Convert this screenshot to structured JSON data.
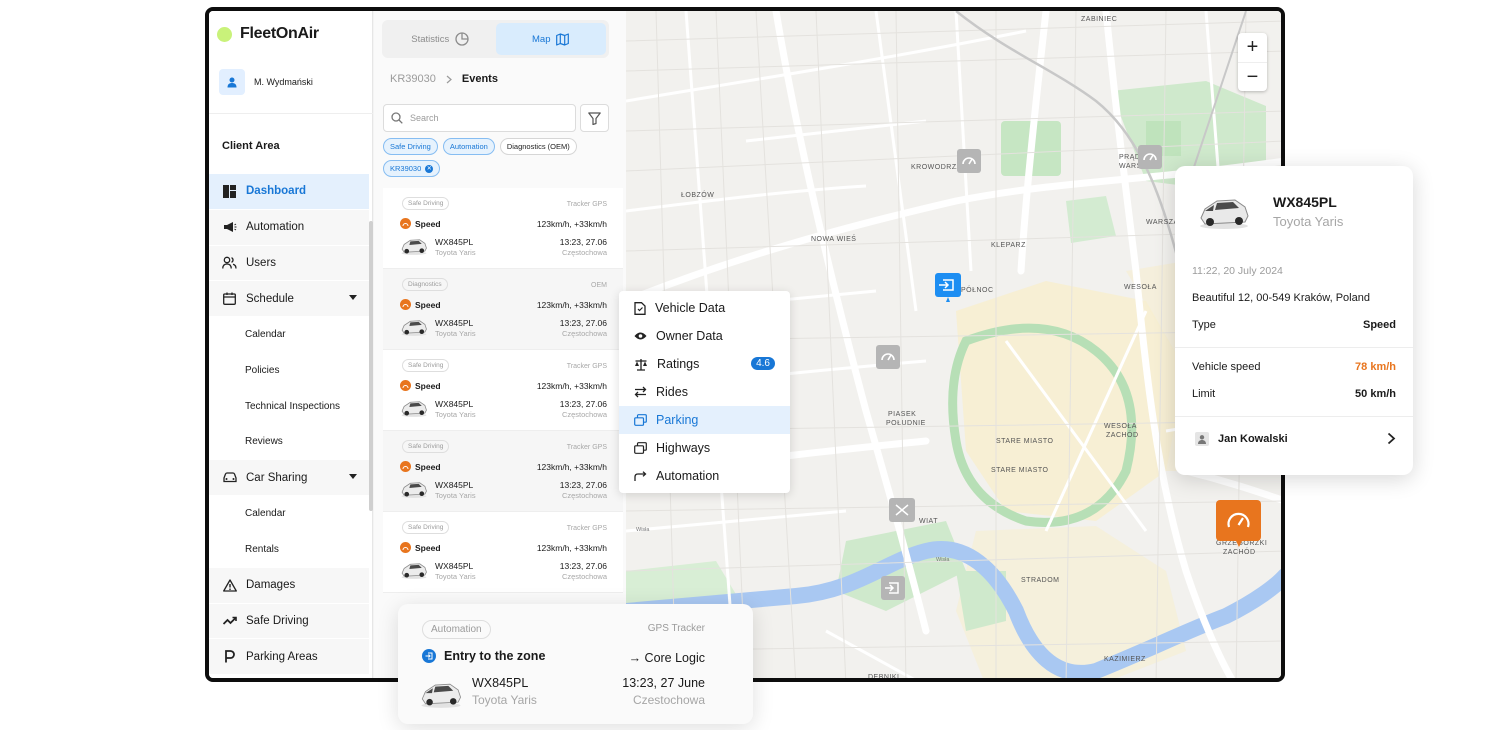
{
  "app": {
    "brand": "FleetOnAir",
    "user_name": "M. Wydmański",
    "section": "Client Area"
  },
  "sidebar": {
    "items": [
      {
        "label": "Dashboard"
      },
      {
        "label": "Automation"
      },
      {
        "label": "Users"
      },
      {
        "label": "Schedule"
      },
      {
        "label": "Calendar"
      },
      {
        "label": "Policies"
      },
      {
        "label": "Technical Inspections"
      },
      {
        "label": "Reviews"
      },
      {
        "label": "Car Sharing"
      },
      {
        "label": "Calendar"
      },
      {
        "label": "Rentals"
      },
      {
        "label": "Damages"
      },
      {
        "label": "Safe Driving"
      },
      {
        "label": "Parking Areas"
      }
    ]
  },
  "panel": {
    "tabs": [
      {
        "label": "Statistics"
      },
      {
        "label": "Map"
      }
    ],
    "breadcrumb": {
      "parent": "KR39030",
      "current": "Events"
    },
    "search_placeholder": "Search",
    "chips": [
      "Safe Driving",
      "Automation",
      "Diagnostics (OEM)",
      "KR39030"
    ],
    "events": [
      {
        "tag": "Safe Driving",
        "source": "Tracker GPS",
        "type": "Speed",
        "speed": "123km/h, +33km/h",
        "plate": "WX845PL",
        "model": "Toyota Yaris",
        "time": "13:23, 27.06",
        "city": "Częstochowa"
      },
      {
        "tag": "Diagnostics",
        "source": "OEM",
        "type": "Speed",
        "speed": "123km/h, +33km/h",
        "plate": "WX845PL",
        "model": "Toyota Yaris",
        "time": "13:23, 27.06",
        "city": "Częstochowa"
      },
      {
        "tag": "Safe Driving",
        "source": "Tracker GPS",
        "type": "Speed",
        "speed": "123km/h, +33km/h",
        "plate": "WX845PL",
        "model": "Toyota Yaris",
        "time": "13:23, 27.06",
        "city": "Częstochowa"
      },
      {
        "tag": "Safe Driving",
        "source": "Tracker GPS",
        "type": "Speed",
        "speed": "123km/h, +33km/h",
        "plate": "WX845PL",
        "model": "Toyota Yaris",
        "time": "13:23, 27.06",
        "city": "Częstochowa"
      },
      {
        "tag": "Safe Driving",
        "source": "Tracker GPS",
        "type": "Speed",
        "speed": "123km/h, +33km/h",
        "plate": "WX845PL",
        "model": "Toyota Yaris",
        "time": "13:23, 27.06",
        "city": "Częstochowa"
      }
    ]
  },
  "map": {
    "zoom_in": "+",
    "zoom_out": "−",
    "labels": [
      "ZABINIEC",
      "KROWODRZA",
      "ŁOBZÓW",
      "NOWA WIEŚ",
      "KLEPARZ",
      "PÓŁNOC",
      "WESOŁA",
      "PRĄDNIK CZERWONY",
      "WARSZAWSKIE",
      "PIASEK POŁUDNIE",
      "STARE MIASTO",
      "WESOŁA ZACHÓD",
      "WIAT",
      "STRADOM",
      "KAZIMIERZ",
      "DĘBNIKI",
      "GRZEGÓRZKI ZACHÓD"
    ]
  },
  "context_menu": {
    "items": [
      {
        "label": "Vehicle Data",
        "icon": "file-icon"
      },
      {
        "label": "Owner Data",
        "icon": "eye-icon"
      },
      {
        "label": "Ratings",
        "icon": "scale-icon",
        "badge": "4.6"
      },
      {
        "label": "Rides",
        "icon": "swap-icon"
      },
      {
        "label": "Parking",
        "icon": "parking-icon"
      },
      {
        "label": "Highways",
        "icon": "highway-icon"
      },
      {
        "label": "Automation",
        "icon": "automation-icon"
      }
    ]
  },
  "vehicle_card": {
    "plate": "WX845PL",
    "model": "Toyota Yaris",
    "datetime": "11:22, 20 July 2024",
    "address": "Beautiful 12, 00-549 Kraków, Poland",
    "type_label": "Type",
    "type_value": "Speed",
    "speed_label": "Vehicle speed",
    "speed_value": "78 km/h",
    "limit_label": "Limit",
    "limit_value": "50 km/h",
    "driver": "Jan Kowalski"
  },
  "automation_popup": {
    "tag": "Automation",
    "source": "GPS Tracker",
    "title": "Entry to the zone",
    "logic": "→ Core Logic",
    "plate": "WX845PL",
    "model": "Toyota Yaris",
    "time": "13:23, 27 June",
    "city": "Czestochowa"
  },
  "colors": {
    "accent": "#1877d6",
    "brand_dot": "#c9f27a",
    "warning": "#e8751e"
  }
}
